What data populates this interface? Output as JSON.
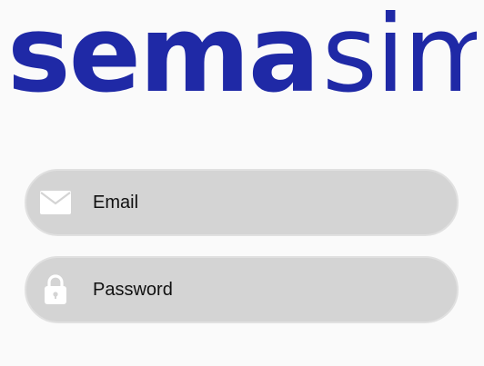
{
  "logo": {
    "part_bold": "sema",
    "part_light": "sim",
    "color": "#1f29a6"
  },
  "form": {
    "email": {
      "placeholder": "Email",
      "value": "",
      "icon": "envelope-icon"
    },
    "password": {
      "placeholder": "Password",
      "value": "",
      "icon": "lock-icon"
    }
  },
  "colors": {
    "background": "#fafafa",
    "field_fill": "#d4d4d4",
    "field_border": "#e0e0e0",
    "icon": "#ffffff",
    "text": "#111111"
  }
}
